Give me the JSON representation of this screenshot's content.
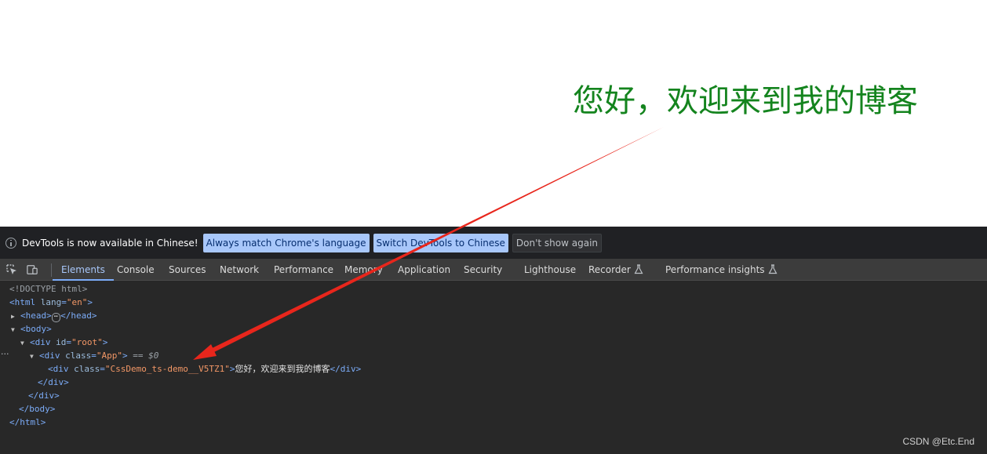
{
  "page": {
    "greeting": "您好，欢迎来到我的博客"
  },
  "devtools": {
    "infobar": {
      "icon": "info-icon",
      "message": "DevTools is now available in Chinese!",
      "buttons": [
        "Always match Chrome's language",
        "Switch DevTools to Chinese",
        "Don't show again"
      ]
    },
    "toolbar_icons": [
      "inspect-element-icon",
      "device-toggle-icon"
    ],
    "tabs": [
      {
        "label": "Elements",
        "active": true
      },
      {
        "label": "Console"
      },
      {
        "label": "Sources"
      },
      {
        "label": "Network"
      },
      {
        "label": "Performance"
      },
      {
        "label": "Memory"
      },
      {
        "label": "Application"
      },
      {
        "label": "Security"
      },
      {
        "label": "Lighthouse"
      },
      {
        "label": "Recorder",
        "icon": "flask-icon"
      },
      {
        "label": "Performance insights",
        "icon": "flask-icon"
      }
    ],
    "dom_tree": {
      "doctype": "<!DOCTYPE html>",
      "html_open": "<html",
      "html_attr": "lang",
      "html_attr_value": "\"en\"",
      "head_open": "<head>",
      "head_close": "</head>",
      "body_open": "<body>",
      "root_open": "<div",
      "root_attr": "id",
      "root_attr_value": "\"root\"",
      "app_open": "<div",
      "app_attr": "class",
      "app_attr_value": "\"App\"",
      "app_selected": "== $0",
      "demo_open": "<div",
      "demo_attr": "class",
      "demo_attr_value": "\"CssDemo_ts-demo__V5TZ1\"",
      "demo_text": "您好，欢迎来到我的博客",
      "div_close": "</div>",
      "body_close": "</body>",
      "html_close": "</html>"
    }
  },
  "watermark": "CSDN @Etc.End",
  "colors": {
    "greeting": "#14841e",
    "arrow": "#e8261c",
    "accent": "#a8c7fa"
  }
}
